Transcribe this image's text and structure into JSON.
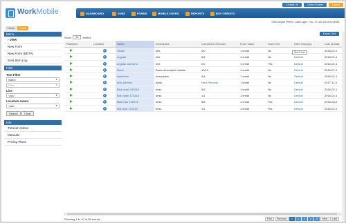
{
  "brand": {
    "name_a": "Work",
    "name_b": "Mobile",
    "tagline": ""
  },
  "top_links": [
    "Contact Us",
    "Centre Screen",
    "Logout"
  ],
  "nav": [
    "DASHBOARD",
    "JOBS",
    "FORMS",
    "MOBILE USERS",
    "REPORTS",
    "BUY CREDITS"
  ],
  "settings": {
    "settings": "Settings",
    "logout": "Log out"
  },
  "user": "Hello Aryan   PRNG: Last Login: Thu, 17 Jan 2019 at 08:58",
  "breadcrumb": [
    "Home",
    "Forms"
  ],
  "menu": {
    "title": "Menu",
    "items": [
      "View",
      "New Form",
      "New Form (BETA)",
      "Sent Item Log"
    ]
  },
  "filter": {
    "title": "Filter",
    "text_filter_label": "Text Filter",
    "text_filter_value": "Name",
    "text_filter_placeholder": "Filter",
    "live_label": "Live",
    "live_value": "<All>",
    "location_label": "Location Aware",
    "location_value": "<All>",
    "search": "Search",
    "clear": "Clear"
  },
  "info": {
    "title": "Info",
    "items": [
      "Tutorial Videos",
      "Manuals",
      "Pricing Plans"
    ]
  },
  "export_label": "Export Grid",
  "show": {
    "prefix": "Show",
    "value": "10",
    "suffix": "entries"
  },
  "columns": [
    "Published",
    "Location",
    "Name",
    "Description",
    "Completed Records",
    "Form Value",
    "Sub Form",
    "User Group(s)",
    "Last Upload"
  ],
  "tooltip": "Sub Form",
  "rows": [
    {
      "name": "15462",
      "desc": "test",
      "records": "0/0",
      "value": "1 credit",
      "sub": "No",
      "group": "Default",
      "upload": "2016-02-1"
    },
    {
      "name": "angular",
      "desc": "test",
      "records": "6/6",
      "value": "1 credit",
      "sub": "No",
      "group": "Default",
      "upload": "2016-01-1"
    },
    {
      "name": "angular sub form",
      "desc": "test",
      "records": "2/2",
      "value": "1 credit",
      "sub": "Yes",
      "group": "Default",
      "upload": "2016-01-1"
    },
    {
      "name": "Basic",
      "desc": "Basic description details",
      "records": "10/10",
      "value": "1 credit",
      "sub": "No",
      "group": "Default",
      "upload": "2016-07-2"
    },
    {
      "name": "basicform",
      "desc": "description",
      "records": "4/4",
      "value": "1 credit",
      "sub": "No",
      "group": "Default",
      "upload": "2016-01-1"
    },
    {
      "name": "blob job tets",
      "desc": "asda",
      "records": "New Records",
      "value": "1 credit",
      "sub": "No",
      "group": "Default",
      "upload": "2017-11-0"
    },
    {
      "name": "Blob main 150216",
      "desc": "desc",
      "records": "5/5",
      "value": "1 credit",
      "sub": "No",
      "group": "Default",
      "upload": "2016-02-1"
    },
    {
      "name": "blob main 170216",
      "desc": "desc",
      "records": "1/1",
      "value": "1 credit",
      "sub": "No",
      "group": "Default",
      "upload": "2016-02-1"
    },
    {
      "name": "Blob Sub 150216",
      "desc": "desc",
      "records": "8/8",
      "value": "1 credit",
      "sub": "Yes",
      "group": "Default",
      "upload": "2016-03-0"
    },
    {
      "name": "blob sub 170216",
      "desc": "desc",
      "records": "1/1",
      "value": "1 credit",
      "sub": "Yes",
      "group": "Default",
      "upload": "2016-02-1"
    }
  ],
  "showing": "Showing 1 to 10 of 56 entries",
  "pager": [
    "First",
    "Previous",
    "1",
    "2",
    "3",
    "4",
    "5",
    "Next",
    "Last"
  ]
}
